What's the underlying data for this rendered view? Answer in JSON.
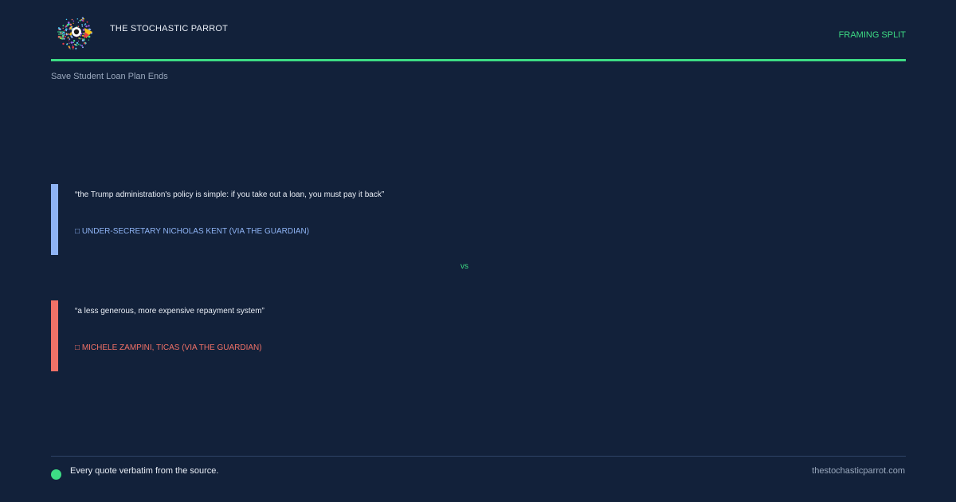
{
  "header": {
    "brand": "THE STOCHASTIC PARROT",
    "tag": "FRAMING SPLIT",
    "logo_icon": "parrot-logo-icon"
  },
  "topic": "Save Student Loan Plan Ends",
  "quotes": [
    {
      "text": "“the Trump administration's policy is simple: if you take out a loan, you must pay it back”",
      "attribution": "UNDER-SECRETARY NICHOLAS KENT (VIA THE GUARDIAN)",
      "attribution_icon": "□",
      "color": "#8fb4f5"
    },
    {
      "text": "“a less generous, more expensive repayment system”",
      "attribution": "MICHELE ZAMPINI, TICAS (VIA THE GUARDIAN)",
      "attribution_icon": "□",
      "color": "#f07167"
    }
  ],
  "vs_label": "vs",
  "footer": {
    "note": "Every quote verbatim from the source.",
    "site": "thestochasticparrot.com"
  },
  "colors": {
    "background": "#12213a",
    "accent": "#3ddc84",
    "quote_a": "#8fb4f5",
    "quote_b": "#f07167"
  }
}
